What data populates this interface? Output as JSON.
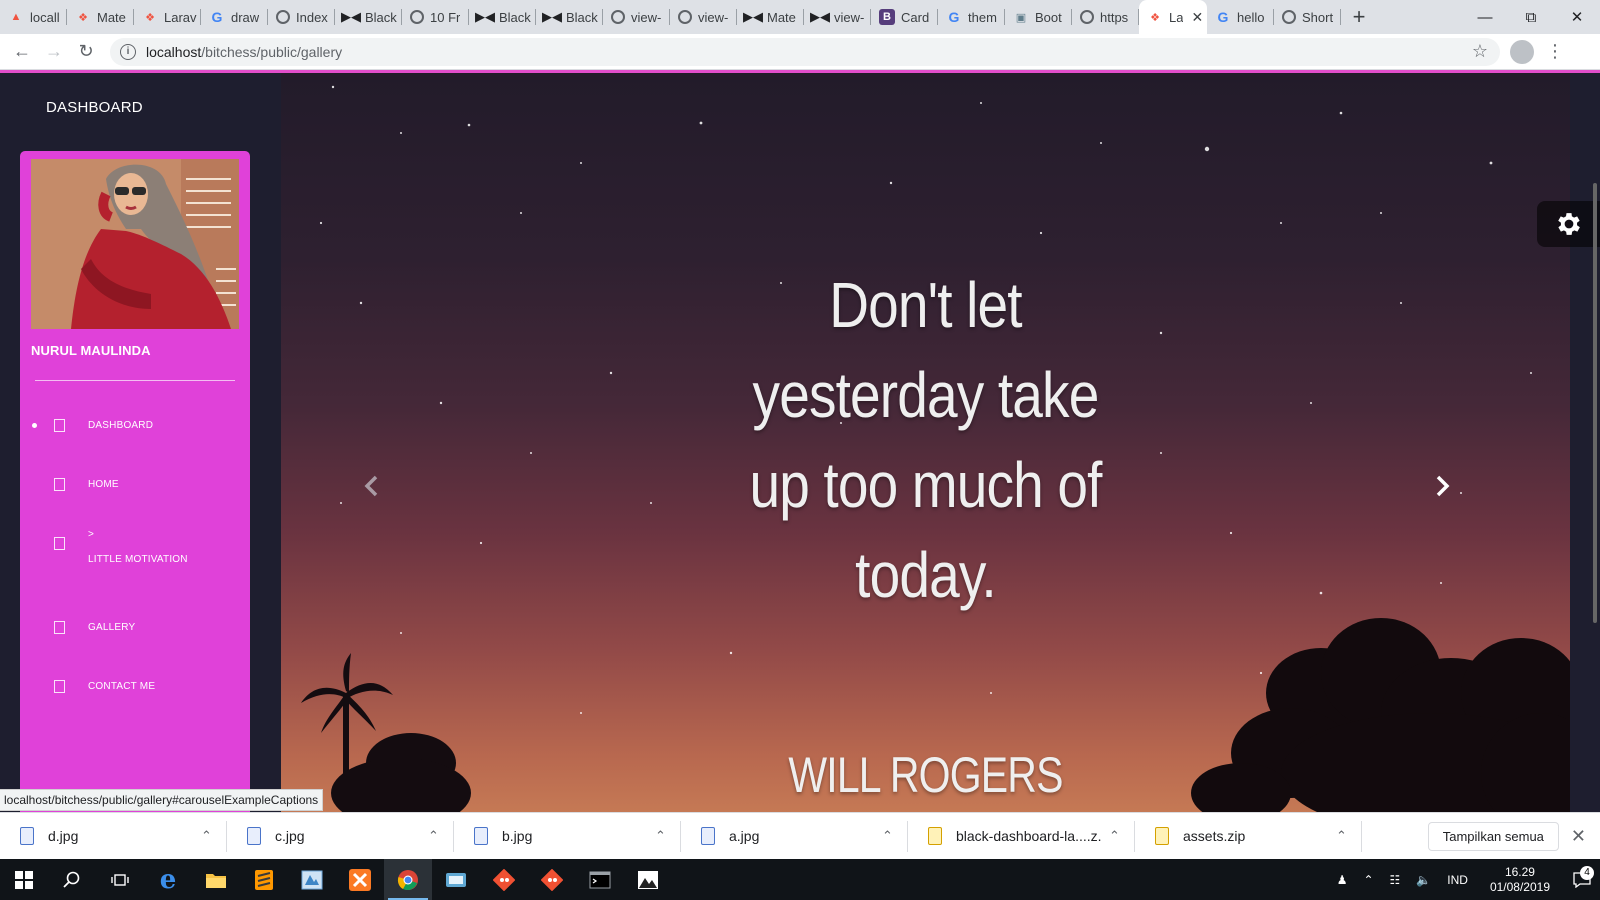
{
  "browser": {
    "tabs": [
      {
        "title": "locall",
        "icon": "xampp-icon"
      },
      {
        "title": "Mate",
        "icon": "laravel-icon"
      },
      {
        "title": "Larav",
        "icon": "laravel-icon"
      },
      {
        "title": "draw",
        "icon": "google-icon"
      },
      {
        "title": "Index",
        "icon": "globe-icon"
      },
      {
        "title": "Black",
        "icon": "bowtie-icon"
      },
      {
        "title": "10 Fr",
        "icon": "globe-icon"
      },
      {
        "title": "Black",
        "icon": "bowtie-icon"
      },
      {
        "title": "Black",
        "icon": "bowtie-icon"
      },
      {
        "title": "view-",
        "icon": "globe-icon"
      },
      {
        "title": "view-",
        "icon": "globe-icon"
      },
      {
        "title": "Mate",
        "icon": "bowtie-icon"
      },
      {
        "title": "view-",
        "icon": "bowtie-icon"
      },
      {
        "title": "Card",
        "icon": "bootstrap-icon"
      },
      {
        "title": "them",
        "icon": "google-icon"
      },
      {
        "title": "Boot",
        "icon": "cube-icon"
      },
      {
        "title": "https",
        "icon": "globe-icon"
      },
      {
        "title": "La",
        "icon": "laravel-icon",
        "active": true
      },
      {
        "title": "hello",
        "icon": "google-icon"
      },
      {
        "title": "Short",
        "icon": "globe-icon"
      }
    ],
    "url_host": "localhost",
    "url_path": "/bitchess/public/gallery",
    "status_url": "localhost/bitchess/public/gallery#carouselExampleCaptions"
  },
  "sidebar": {
    "brand": "DASHBOARD",
    "profile_name": "NURUL MAULINDA",
    "items": [
      {
        "label": "DASHBOARD",
        "active": true
      },
      {
        "label": "HOME"
      },
      {
        "caret": ">",
        "label": "LITTLE MOTIVATION"
      },
      {
        "label": "GALLERY"
      },
      {
        "label": "CONTACT ME"
      }
    ]
  },
  "carousel": {
    "quote_lines": [
      "Don't let",
      "yesterday take",
      "up too much of",
      "today."
    ],
    "author": "WILL ROGERS"
  },
  "downloads": {
    "files": [
      "d.jpg",
      "c.jpg",
      "b.jpg",
      "a.jpg",
      "black-dashboard-la....z...",
      "assets.zip"
    ],
    "show_all": "Tampilkan semua"
  },
  "taskbar": {
    "language": "IND",
    "time": "16.29",
    "date": "01/08/2019",
    "notifications": "4"
  },
  "colors": {
    "sidebar": "#e041d9",
    "accent_line": "#e14eca",
    "page_bg": "#1e1e2f"
  }
}
